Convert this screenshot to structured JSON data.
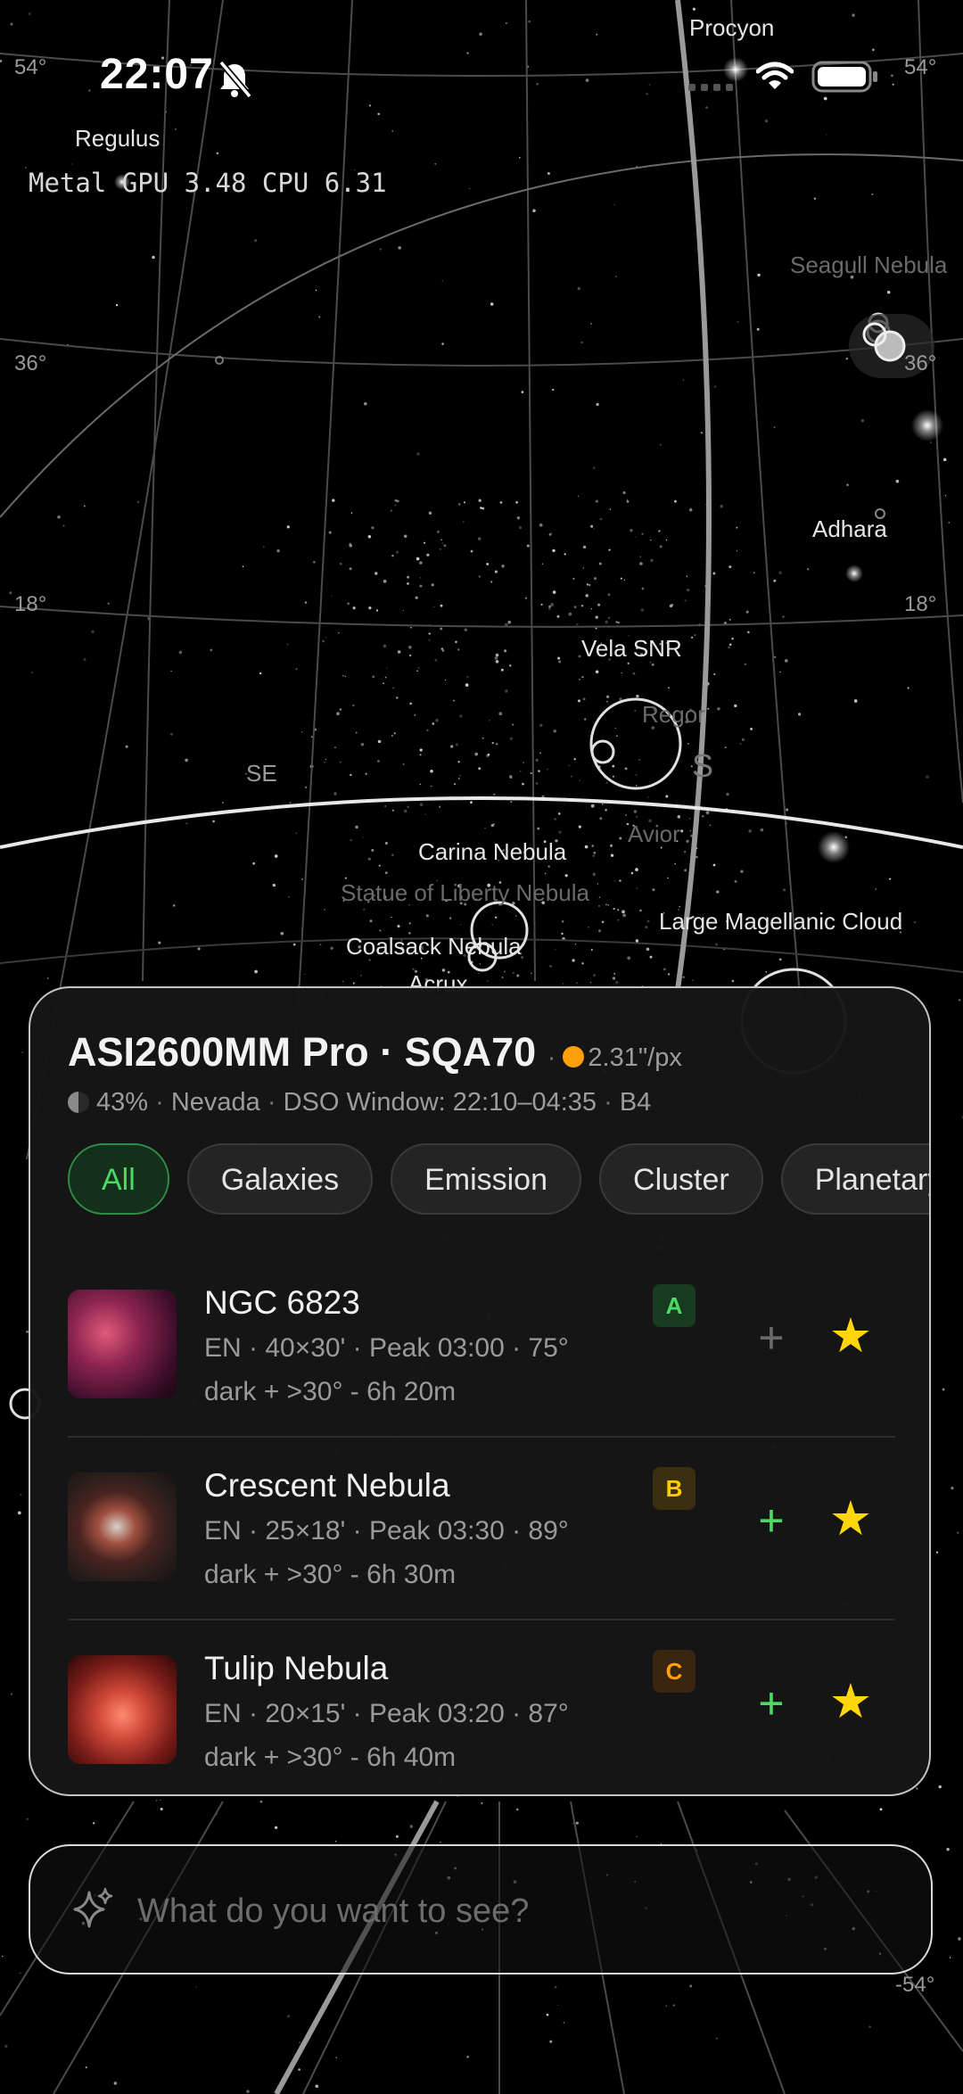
{
  "status_bar": {
    "time": "22:07",
    "icons": [
      "bell-slash-icon",
      "signal-icon",
      "wifi-icon",
      "battery-icon"
    ]
  },
  "perf_overlay": "Metal GPU 3.48 CPU 6.31",
  "sky_labels": {
    "procyon": "Procyon",
    "regulus": "Regulus",
    "seagull": "Seagull Nebula",
    "adhara": "Adhara",
    "vela": "Vela SNR",
    "regor": "Regor",
    "compass_s": "S",
    "compass_se": "SE",
    "avior": "Avior",
    "carina": "Carina Nebula",
    "statue": "Statue of Liberty Nebula",
    "lmc": "Large Magellanic Cloud",
    "coalsack": "Coalsack Nebula",
    "acrux": "Acrux"
  },
  "grid_labels": {
    "l54": "54°",
    "r54": "54°",
    "l36": "36°",
    "r36": "36°",
    "l18": "18°",
    "r18": "18°",
    "rm54": "-54°"
  },
  "colors": {
    "accent_green": "#4cd964",
    "orange": "#ff9f0a",
    "star": "#ffd60a"
  },
  "panel": {
    "title": "ASI2600MM Pro · SQA70",
    "separator": "·",
    "pixel_scale": "2.31\"/px",
    "moon_percent": "43%",
    "location": "Nevada",
    "window": "DSO Window: 22:10–04:35",
    "bortle": "B4",
    "dot": "·",
    "filters": [
      "All",
      "Galaxies",
      "Emission",
      "Cluster",
      "Planetary"
    ],
    "targets": [
      {
        "name": "NGC 6823",
        "meta": "EN · 40×30' · Peak 03:00 · 75°",
        "visibility": "dark + >30° - 6h 20m",
        "grade": "A",
        "grade_color": "#4cd964",
        "added": false
      },
      {
        "name": "Crescent Nebula",
        "meta": "EN · 25×18' · Peak 03:30 · 89°",
        "visibility": "dark + >30° - 6h 30m",
        "grade": "B",
        "grade_color": "#ffcc00",
        "added": true
      },
      {
        "name": "Tulip Nebula",
        "meta": "EN · 20×15' · Peak 03:20 · 87°",
        "visibility": "dark + >30° - 6h 40m",
        "grade": "C",
        "grade_color": "#ff9f0a",
        "added": true
      }
    ],
    "plus_symbol": "+",
    "star_symbol": "★"
  },
  "search": {
    "placeholder": "What do you want to see?"
  }
}
